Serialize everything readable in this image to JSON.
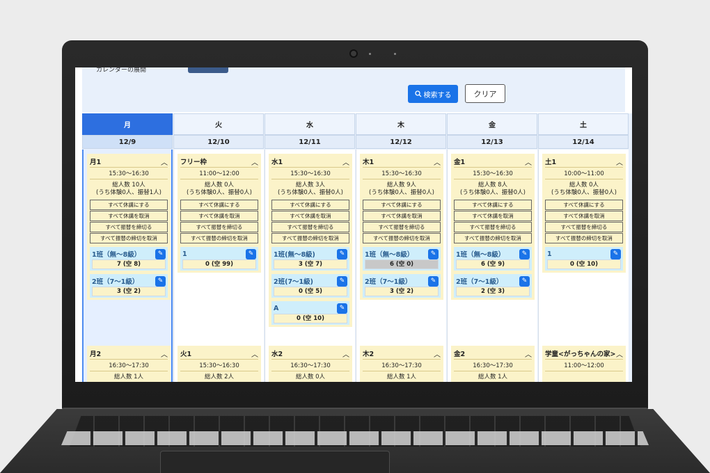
{
  "toolbar": {
    "calendar_toggle_label": "カレンダーの展開",
    "search_label": "検索する",
    "clear_label": "クリア"
  },
  "bulk_actions": [
    "すべて休講にする",
    "すべて休講を取消",
    "すべて振替を締切る",
    "すべて振替の締切を取消"
  ],
  "days": [
    {
      "dow": "月",
      "date": "12/9",
      "active": true,
      "card": {
        "title": "月1",
        "time": "15:30〜16:30",
        "total": "総人数 10人",
        "detail": "(うち体験0人、振替1人)",
        "classes": [
          {
            "name": "1班（無〜8級）",
            "value": "7 (空 8)"
          },
          {
            "name": "2班（7〜1級）",
            "value": "3 (空 2)"
          }
        ]
      },
      "card2": {
        "title": "月2",
        "time": "16:30〜17:30",
        "total": "総人数 1人"
      }
    },
    {
      "dow": "火",
      "date": "12/10",
      "card": {
        "title": "フリー枠",
        "time": "11:00〜12:00",
        "total": "総人数 0人",
        "detail": "(うち体験0人、振替0人)",
        "classes": [
          {
            "name": "1",
            "value": "0 (空 99)"
          }
        ]
      },
      "card2": {
        "title": "火1",
        "time": "15:30〜16:30",
        "total": "総人数 2人"
      }
    },
    {
      "dow": "水",
      "date": "12/11",
      "card": {
        "title": "水1",
        "time": "15:30〜16:30",
        "total": "総人数 3人",
        "detail": "(うち体験0人、振替0人)",
        "classes": [
          {
            "name": "1班(無〜8級)",
            "value": "3 (空 7)"
          },
          {
            "name": "2班(7〜1級)",
            "value": "0 (空 5)"
          },
          {
            "name": "A",
            "value": "0 (空 10)"
          }
        ]
      },
      "card2": {
        "title": "水2",
        "time": "16:30〜17:30",
        "total": "総人数 0人"
      }
    },
    {
      "dow": "木",
      "date": "12/12",
      "card": {
        "title": "木1",
        "time": "15:30〜16:30",
        "total": "総人数 9人",
        "detail": "(うち体験0人、振替0人)",
        "classes": [
          {
            "name": "1班（無〜8級）",
            "value": "6 (空 0)",
            "full": true
          },
          {
            "name": "2班（7〜1級）",
            "value": "3 (空 2)"
          }
        ]
      },
      "card2": {
        "title": "木2",
        "time": "16:30〜17:30",
        "total": "総人数 1人"
      }
    },
    {
      "dow": "金",
      "date": "12/13",
      "card": {
        "title": "金1",
        "time": "15:30〜16:30",
        "total": "総人数 8人",
        "detail": "(うち体験0人、振替0人)",
        "classes": [
          {
            "name": "1班（無〜8級）",
            "value": "6 (空 9)"
          },
          {
            "name": "2班（7〜1級）",
            "value": "2 (空 3)"
          }
        ]
      },
      "card2": {
        "title": "金2",
        "time": "16:30〜17:30",
        "total": "総人数 1人"
      }
    },
    {
      "dow": "土",
      "date": "12/14",
      "card": {
        "title": "土1",
        "time": "10:00〜11:00",
        "total": "総人数 0人",
        "detail": "(うち体験0人、振替0人)",
        "classes": [
          {
            "name": "1",
            "value": "0 (空 10)"
          }
        ]
      },
      "card2": {
        "title": "学童<がっちゃんの家>",
        "time": "11:00〜12:00",
        "total": ""
      }
    }
  ]
}
